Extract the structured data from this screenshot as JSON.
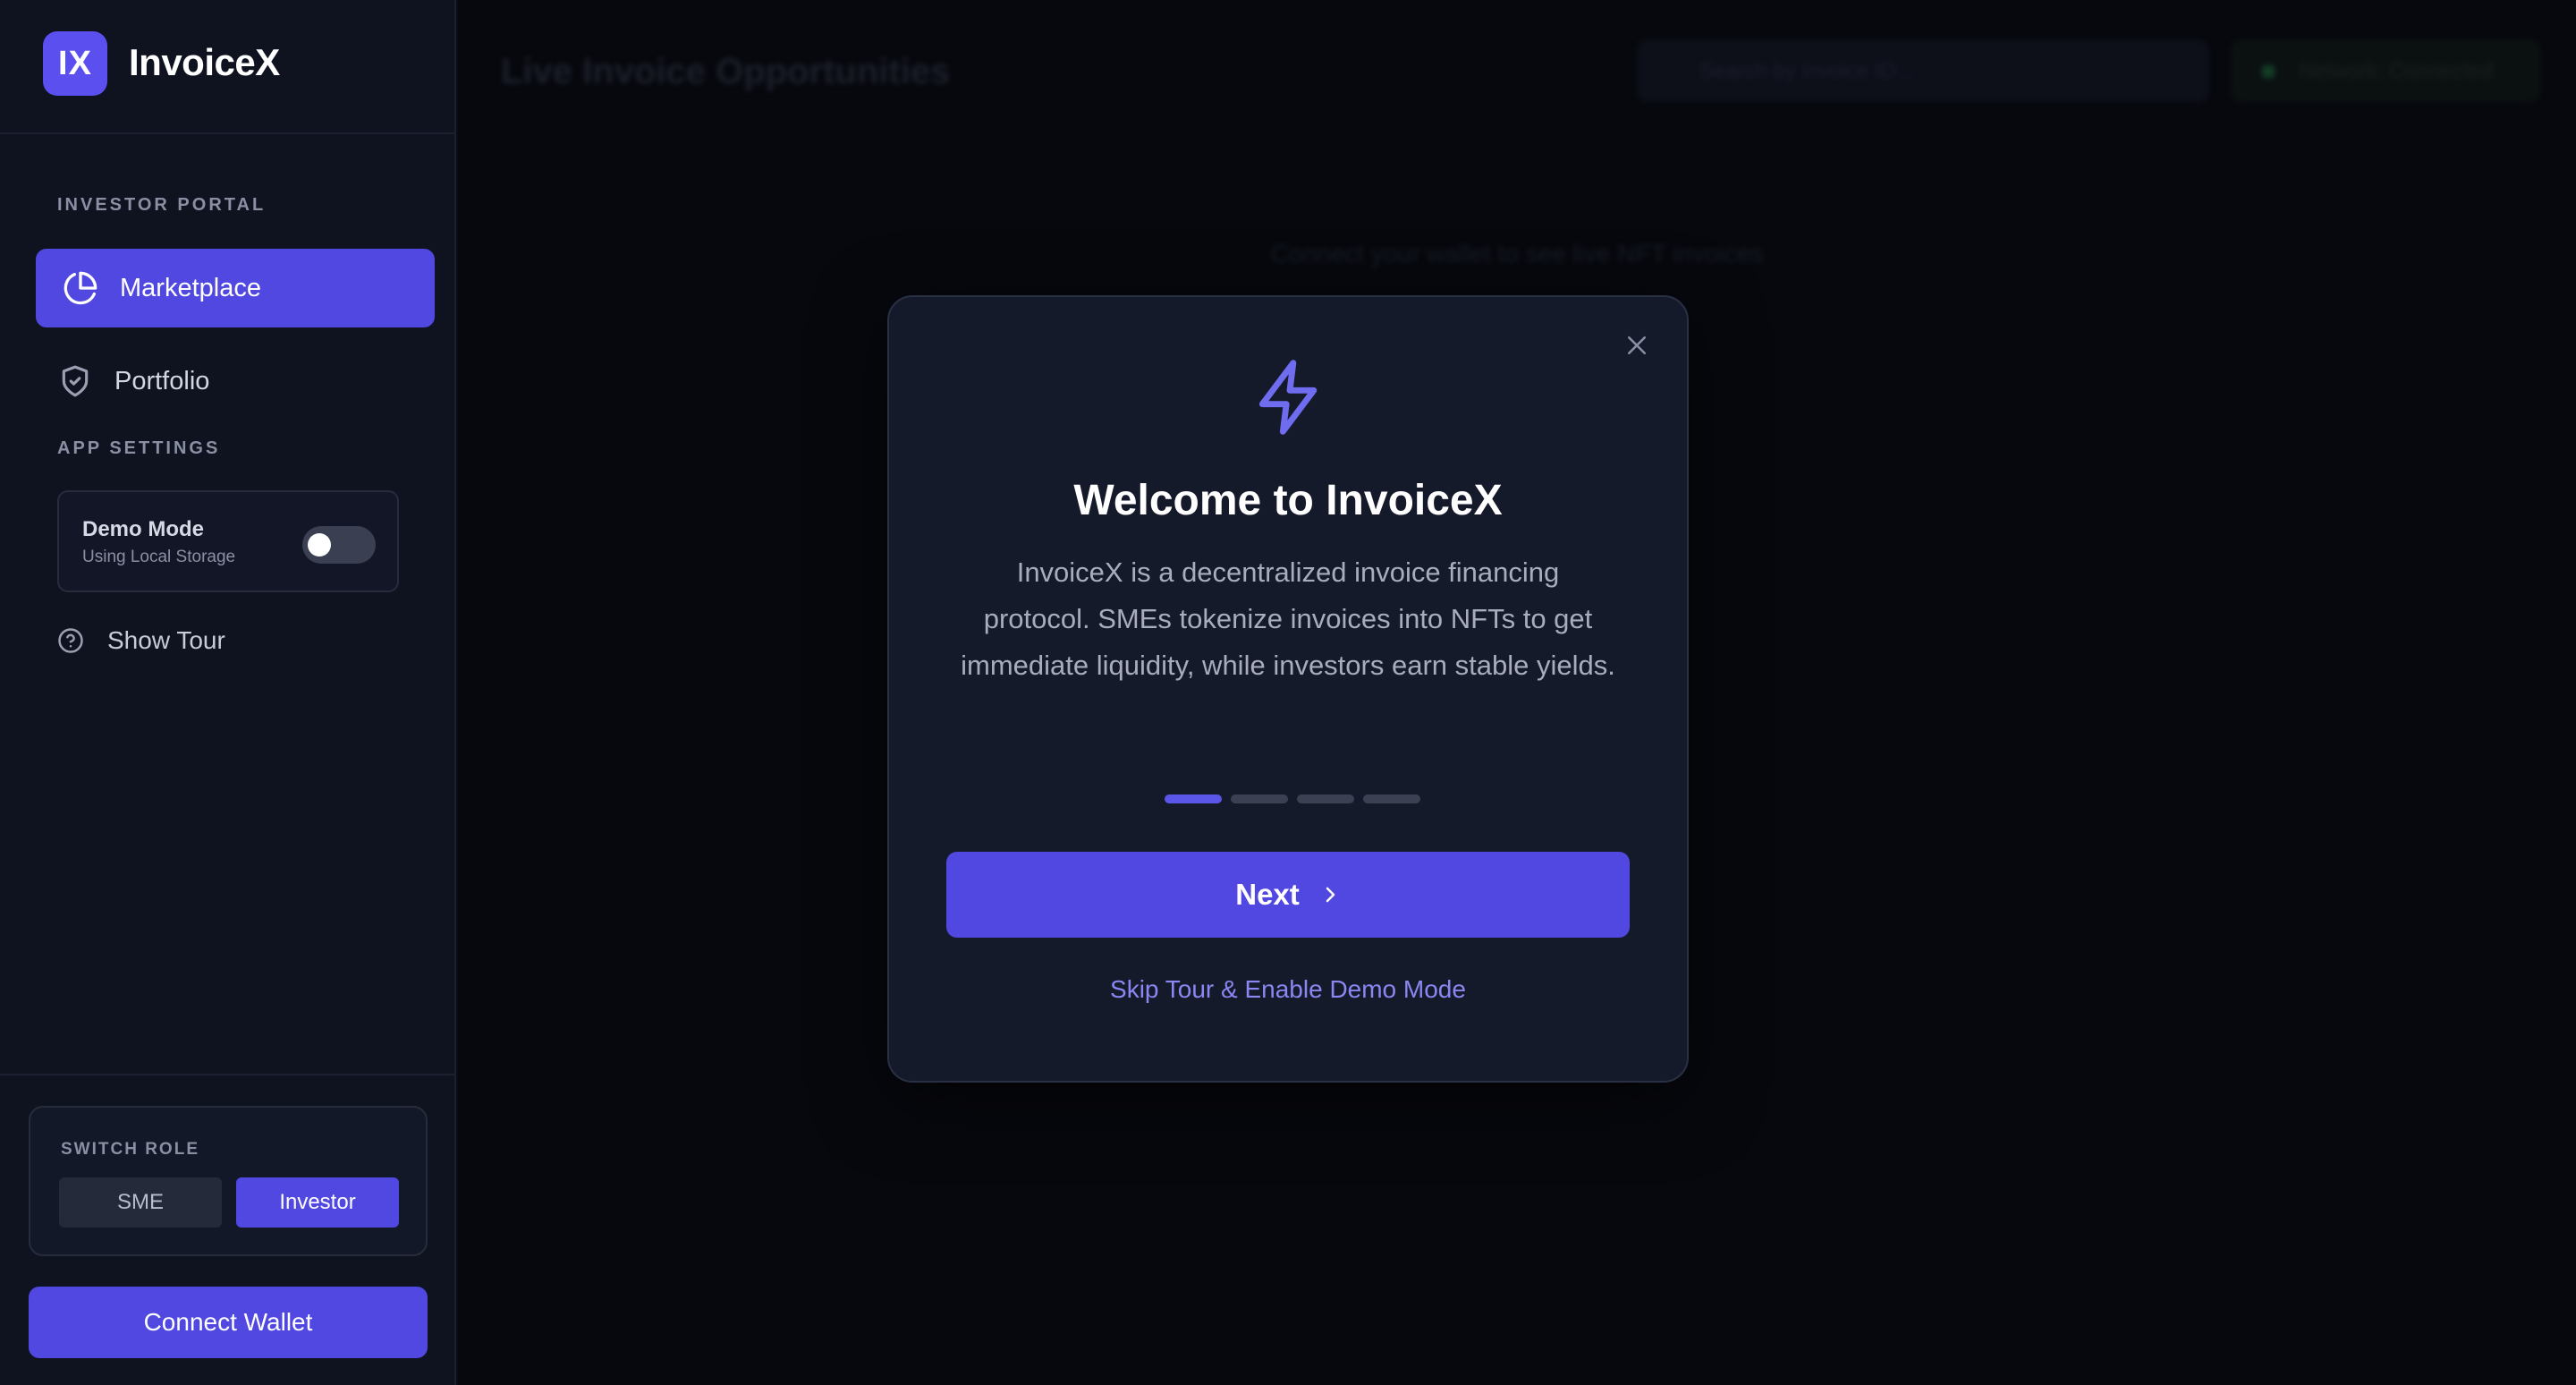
{
  "brand": {
    "logo": "IX",
    "name": "InvoiceX"
  },
  "sidebar": {
    "investor_label": "INVESTOR PORTAL",
    "items": [
      {
        "label": "Marketplace",
        "icon": "pie-chart-icon",
        "active": true
      },
      {
        "label": "Portfolio",
        "icon": "shield-check-icon",
        "active": false
      }
    ],
    "settings_label": "APP SETTINGS",
    "demo": {
      "title": "Demo Mode",
      "subtitle": "Using Local Storage",
      "enabled": false
    },
    "tour_label": "Show Tour",
    "role": {
      "label": "SWITCH ROLE",
      "sme": "SME",
      "investor": "Investor",
      "selected": "Investor"
    },
    "connect_label": "Connect Wallet"
  },
  "main": {
    "title": "Live Invoice Opportunities",
    "search_placeholder": "Search by invoice ID...",
    "status": "Network: Connected",
    "empty_text": "Connect your wallet to see live NFT invoices"
  },
  "modal": {
    "title": "Welcome to InvoiceX",
    "body": "InvoiceX is a decentralized invoice financing protocol. SMEs tokenize invoices into NFTs to get immediate liquidity, while investors earn stable yields.",
    "step_current": 1,
    "step_total": 4,
    "next_label": "Next",
    "skip_label": "Skip Tour & Enable Demo Mode"
  },
  "colors": {
    "accent": "#5048e0",
    "background": "#0b0d16",
    "sidebar": "#0f1320",
    "modal": "#151a2b",
    "link": "#8a86f2"
  }
}
